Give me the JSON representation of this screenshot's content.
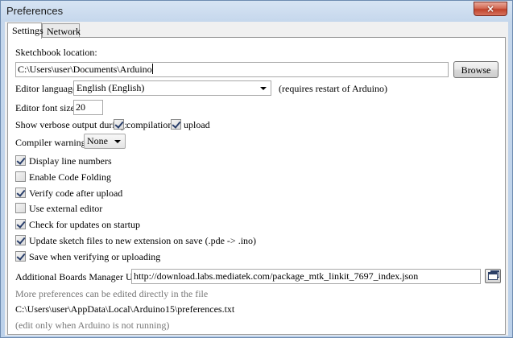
{
  "window": {
    "title": "Preferences",
    "close_glyph": "×"
  },
  "tabs": [
    {
      "label": "Settings"
    },
    {
      "label": "Network"
    }
  ],
  "settings": {
    "sketchbook_label": "Sketchbook location:",
    "sketchbook_value": "C:\\Users\\user\\Documents\\Arduino",
    "browse_label": "Browse",
    "language_label": "Editor language:",
    "language_value": "English (English)",
    "language_note": "(requires restart of Arduino)",
    "font_size_label": "Editor font size:",
    "font_size_value": "20",
    "verbose_label": "Show verbose output during:",
    "verbose_compilation": {
      "label": "compilation",
      "checked": true
    },
    "verbose_upload": {
      "label": "upload",
      "checked": true
    },
    "warnings_label": "Compiler warnings:",
    "warnings_value": "None",
    "options": [
      {
        "label": "Display line numbers",
        "checked": true
      },
      {
        "label": "Enable Code Folding",
        "checked": false
      },
      {
        "label": "Verify code after upload",
        "checked": true
      },
      {
        "label": "Use external editor",
        "checked": false
      },
      {
        "label": "Check for updates on startup",
        "checked": true
      },
      {
        "label": "Update sketch files to new extension on save (.pde -> .ino)",
        "checked": true
      },
      {
        "label": "Save when verifying or uploading",
        "checked": true
      }
    ],
    "boards_url_label": "Additional Boards Manager URLs:",
    "boards_url_value": "http://download.labs.mediatek.com/package_mtk_linkit_7697_index.json",
    "more_prefs_note": "More preferences can be edited directly in the file",
    "prefs_path": "C:\\Users\\user\\AppData\\Local\\Arduino15\\preferences.txt",
    "edit_note": "(edit only when Arduino is not running)"
  }
}
